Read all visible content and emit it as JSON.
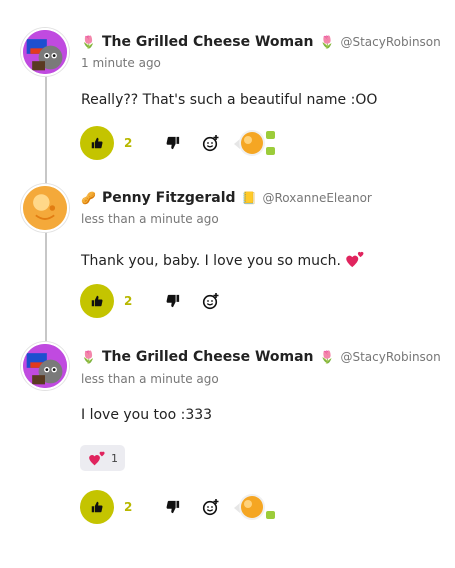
{
  "comments": [
    {
      "author_badge": "🌷",
      "author": "The Grilled Cheese Woman",
      "author_badge_after": "🌷",
      "handle": "@StacyRobinson",
      "time": "1 minute ago",
      "text": "Really?? That's such a beautiful name :OO",
      "likes": "2"
    },
    {
      "author_badge": "🥜",
      "author": "Penny Fitzgerald",
      "author_badge_after": "📒",
      "handle": "@RoxanneEleanor",
      "time": "less than a minute ago",
      "text": "Thank you, baby. I love you so much.",
      "likes": "2"
    },
    {
      "author_badge": "🌷",
      "author": "The Grilled Cheese Woman",
      "author_badge_after": "🌷",
      "handle": "@StacyRobinson",
      "time": "less than a minute ago",
      "text": "I love you too :333",
      "reaction_count": "1",
      "likes": "2"
    }
  ],
  "colors": {
    "like_accent": "#c4c400",
    "heart": "#e0245e",
    "thread_line": "#c7c7c7"
  },
  "icons": {
    "like": "thumbs-up-icon",
    "dislike": "thumbs-down-icon",
    "add_reaction": "add-reaction-icon",
    "heart": "two-hearts-icon"
  }
}
